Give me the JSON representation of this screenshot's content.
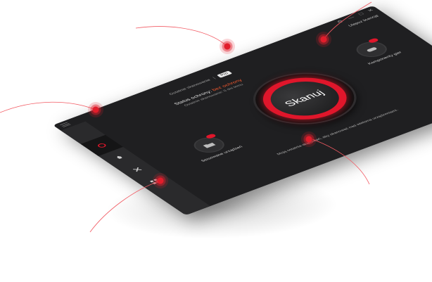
{
  "app": {
    "window_controls": [
      "⚙",
      "—",
      "□",
      "✕"
    ],
    "top_right_link": "Ulepsz licencję",
    "tabs": {
      "left": "Ostatnie skanowanie",
      "sep": "|",
      "active": "Pro"
    },
    "status": {
      "label": "Status ochrony:",
      "value": "bez ochrony"
    },
    "last_scan": "Ostatnie skanowanie: 0 dni temu",
    "scan_button": "Skanuj",
    "features": {
      "left": {
        "label": "Stosowane urządzeń",
        "icon": "folder-icon"
      },
      "right": {
        "label": "Komponenty gier",
        "icon": "gamepad-icon"
      }
    },
    "bottom_message": "Moją ostatnia skanowań, aby skanować nad wieloma urządzeniami.",
    "sidebar": [
      {
        "icon": "shield-icon",
        "active": true
      },
      {
        "icon": "rocket-icon",
        "active": false
      },
      {
        "icon": "tools-icon",
        "active": false
      },
      {
        "icon": "grid-icon",
        "active": false
      }
    ]
  },
  "colors": {
    "accent": "#e0162b",
    "warning": "#ff5b2e",
    "window_bg": "#1f1f21",
    "sidebar_bg": "#2a2a2c"
  }
}
